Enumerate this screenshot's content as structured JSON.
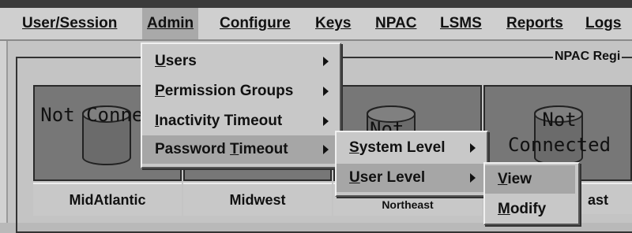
{
  "menubar": {
    "items": [
      {
        "label": "User/Session",
        "key": "U",
        "rest": "ser/Session"
      },
      {
        "label": "Admin",
        "key": "A",
        "rest": "dmin"
      },
      {
        "label": "Configure",
        "key": "C",
        "rest": "onfigure"
      },
      {
        "label": "Keys",
        "key": "K",
        "rest": "eys"
      },
      {
        "label": "NPAC",
        "key": "N",
        "rest": "PAC"
      },
      {
        "label": "LSMS",
        "key": "L",
        "rest": "SMS"
      },
      {
        "label": "Reports",
        "key": "R",
        "rest": "eports"
      },
      {
        "label": "Logs",
        "key": "",
        "rest": "Logs"
      }
    ]
  },
  "group_title": "NPAC Regi",
  "regions": [
    {
      "name": "MidAtlantic",
      "status": "Not Connecte"
    },
    {
      "name": "Midwest",
      "status": ""
    },
    {
      "name": "Northeast",
      "status": "Not"
    },
    {
      "name": "ast",
      "status": "Not Connected"
    }
  ],
  "admin_menu": {
    "items": [
      {
        "pre": "",
        "key": "U",
        "rest": "sers"
      },
      {
        "pre": "",
        "key": "P",
        "rest": "ermission Groups"
      },
      {
        "pre": "",
        "key": "I",
        "rest": "nactivity Timeout"
      },
      {
        "pre": "Password ",
        "key": "T",
        "rest": "imeout"
      }
    ]
  },
  "password_menu": {
    "items": [
      {
        "key": "S",
        "rest": "ystem Level"
      },
      {
        "key": "U",
        "rest": "ser Level"
      }
    ]
  },
  "user_level_menu": {
    "items": [
      {
        "key": "V",
        "rest": "iew"
      },
      {
        "key": "M",
        "rest": "odify"
      }
    ]
  },
  "colors": {
    "menubar": "#cfcfcf",
    "highlight": "#a6a6a6",
    "panel": "#c4c4c4",
    "region_box": "#777777"
  }
}
